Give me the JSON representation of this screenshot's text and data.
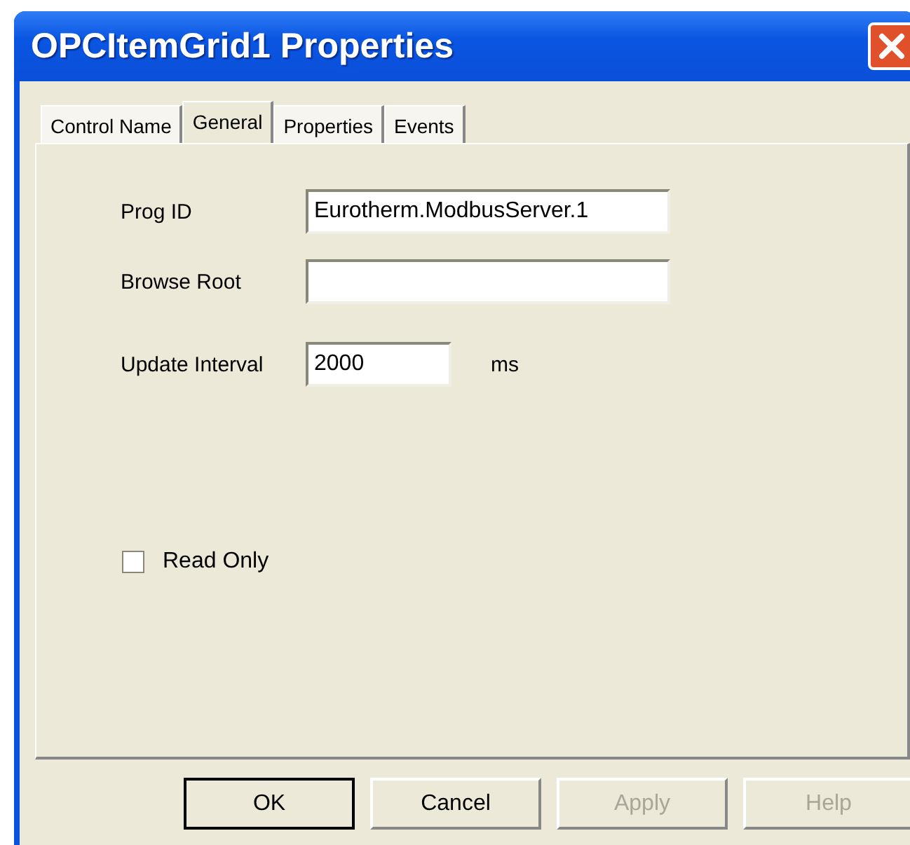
{
  "window": {
    "title": "OPCItemGrid1 Properties"
  },
  "tabs": [
    {
      "label": "Control Name",
      "selected": false
    },
    {
      "label": "General",
      "selected": true
    },
    {
      "label": "Properties",
      "selected": false
    },
    {
      "label": "Events",
      "selected": false
    }
  ],
  "fields": [
    {
      "label": "Prog ID",
      "value": "Eurotherm.ModbusServer.1",
      "kind": "wide"
    },
    {
      "label": "Browse Root",
      "kind": "wide"
    },
    {
      "label": "Update Interval",
      "value": "2000",
      "unit": "ms",
      "kind": "narrow"
    }
  ],
  "read_only": {
    "label": "Read Only",
    "checked": false
  },
  "buttons": [
    {
      "label": "OK",
      "disabled": false,
      "default": true
    },
    {
      "label": "Cancel",
      "disabled": false,
      "default": false
    },
    {
      "label": "Apply",
      "disabled": true,
      "default": false
    },
    {
      "label": "Help",
      "disabled": true,
      "default": false
    }
  ]
}
